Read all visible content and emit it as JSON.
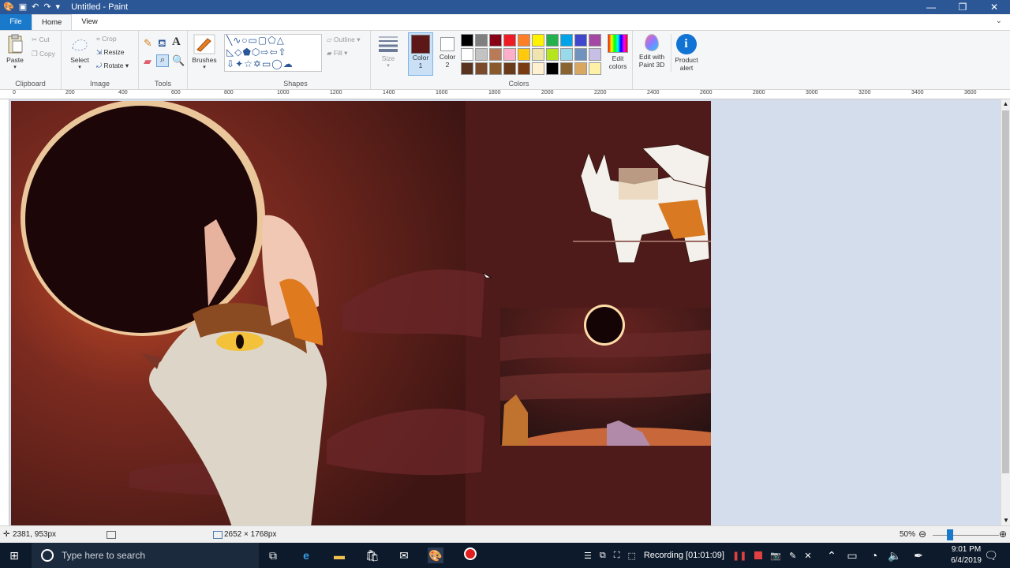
{
  "window": {
    "title": "Untitled - Paint"
  },
  "tabs": {
    "file": "File",
    "home": "Home",
    "view": "View"
  },
  "clipboard": {
    "paste": "Paste",
    "cut": "Cut",
    "copy": "Copy",
    "group": "Clipboard"
  },
  "image": {
    "select": "Select",
    "crop": "Crop",
    "resize": "Resize",
    "rotate": "Rotate",
    "group": "Image"
  },
  "tools": {
    "group": "Tools",
    "brushes": "Brushes"
  },
  "shapes": {
    "group": "Shapes",
    "outline": "Outline",
    "fill": "Fill"
  },
  "size": {
    "label": "Size"
  },
  "colors": {
    "color1": "Color",
    "color1_num": "1",
    "color2": "Color",
    "color2_num": "2",
    "edit": "Edit colors",
    "group": "Colors",
    "palette": [
      "#000000",
      "#7f7f7f",
      "#880015",
      "#ed1c24",
      "#ff7f27",
      "#fff200",
      "#22b14c",
      "#00a2e8",
      "#3f48cc",
      "#a349a4",
      "#ffffff",
      "#c3c3c3",
      "#b97a57",
      "#ffaec9",
      "#ffc90e",
      "#efe4b0",
      "#b5e61d",
      "#99d9ea",
      "#7092be",
      "#c8bfe7",
      "#5a3320",
      "#7a4a2a",
      "#8a5a2b",
      "#6b3a1a",
      "#7a3b12",
      "#fff0d0",
      "#000000",
      "#8a6430",
      "#d8a860",
      "#fff0a8"
    ],
    "active_color1": "#5e1718",
    "active_color2": "#ffffff"
  },
  "paint3d": {
    "label": "Edit with Paint 3D"
  },
  "product_alert": {
    "label": "Product alert"
  },
  "ruler": {
    "marks": [
      "0",
      "200",
      "400",
      "600",
      "800",
      "1000",
      "1200",
      "1400",
      "1600",
      "1800",
      "2000",
      "2200",
      "2400",
      "2600",
      "2800",
      "3000",
      "3200",
      "3400",
      "3600"
    ]
  },
  "status": {
    "cursor": "2381, 953px",
    "size": "2652 × 1768px",
    "zoom": "50%"
  },
  "taskbar": {
    "search_placeholder": "Type here to search",
    "recording": "Recording [01:01:09]",
    "time": "9:01 PM",
    "date": "6/4/2019"
  }
}
